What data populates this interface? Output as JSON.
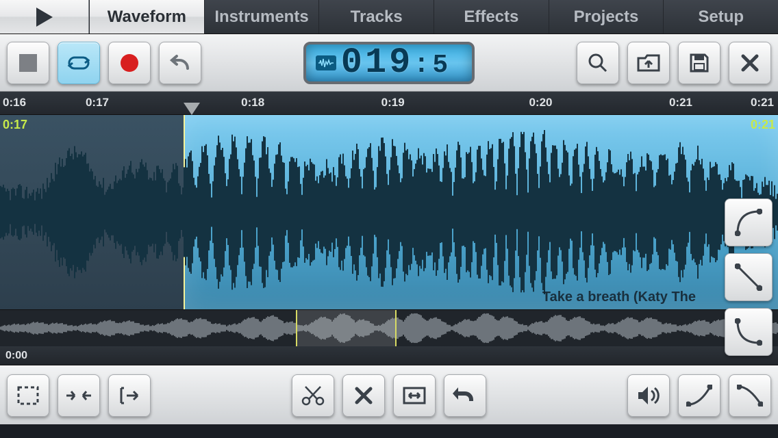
{
  "tabs": {
    "items": [
      "Waveform",
      "Instruments",
      "Tracks",
      "Effects",
      "Projects",
      "Setup"
    ],
    "active_index": 0
  },
  "transport": {
    "display": "019",
    "display_fraction": "5",
    "loop_on": true
  },
  "ruler": {
    "ticks": [
      "0:16",
      "0:17",
      "0:18",
      "0:19",
      "0:20",
      "0:21"
    ],
    "marker_positions_pct": [
      23.6
    ]
  },
  "selection": {
    "start_label": "0:17",
    "end_label": "0:21"
  },
  "track": {
    "name": "Take a breath (Katy The"
  },
  "overview": {
    "start_label": "0:00",
    "window_left_pct": 38,
    "window_right_pct": 51
  }
}
